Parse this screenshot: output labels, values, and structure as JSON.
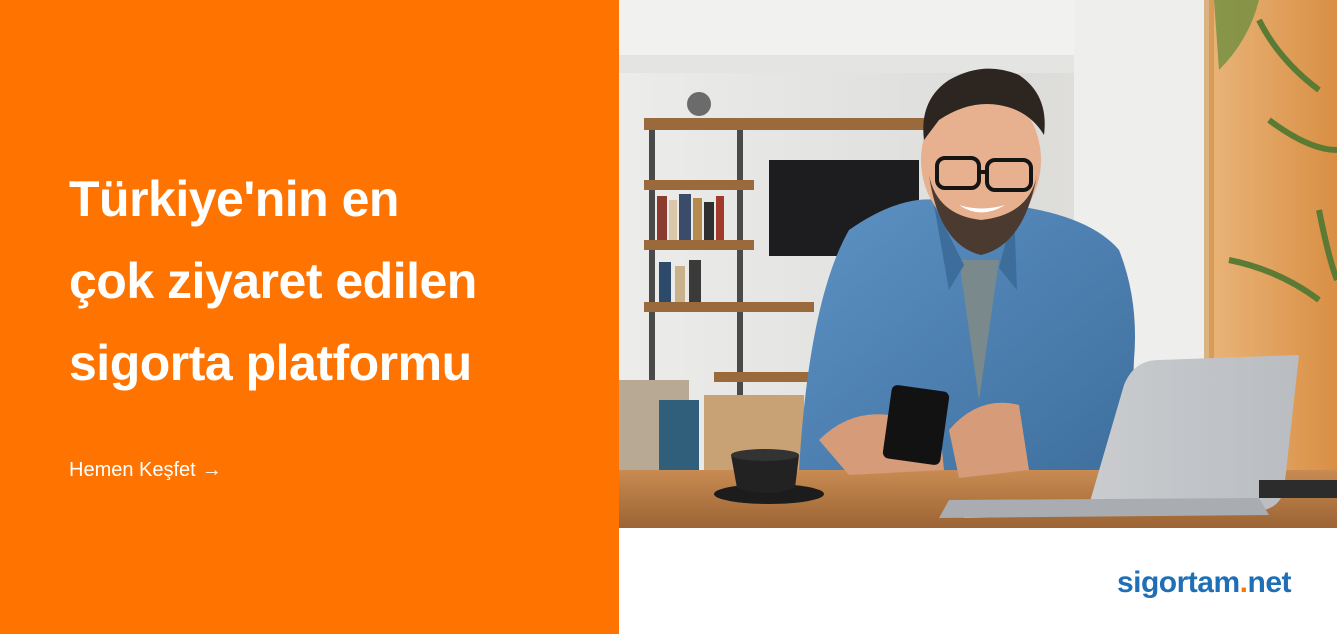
{
  "hero": {
    "headline_lines": [
      "Türkiye'nin en",
      "çok ziyaret edilen",
      "sigorta platformu"
    ],
    "cta_label": "Hemen Keşfet",
    "cta_arrow": "→"
  },
  "brand": {
    "logo_name": "sigortam",
    "logo_dot": ".",
    "logo_tld": "net",
    "primary_color": "#ff7300",
    "logo_color": "#1e6fb5"
  },
  "photo": {
    "icon": "man-with-phone-and-laptop-photo"
  }
}
